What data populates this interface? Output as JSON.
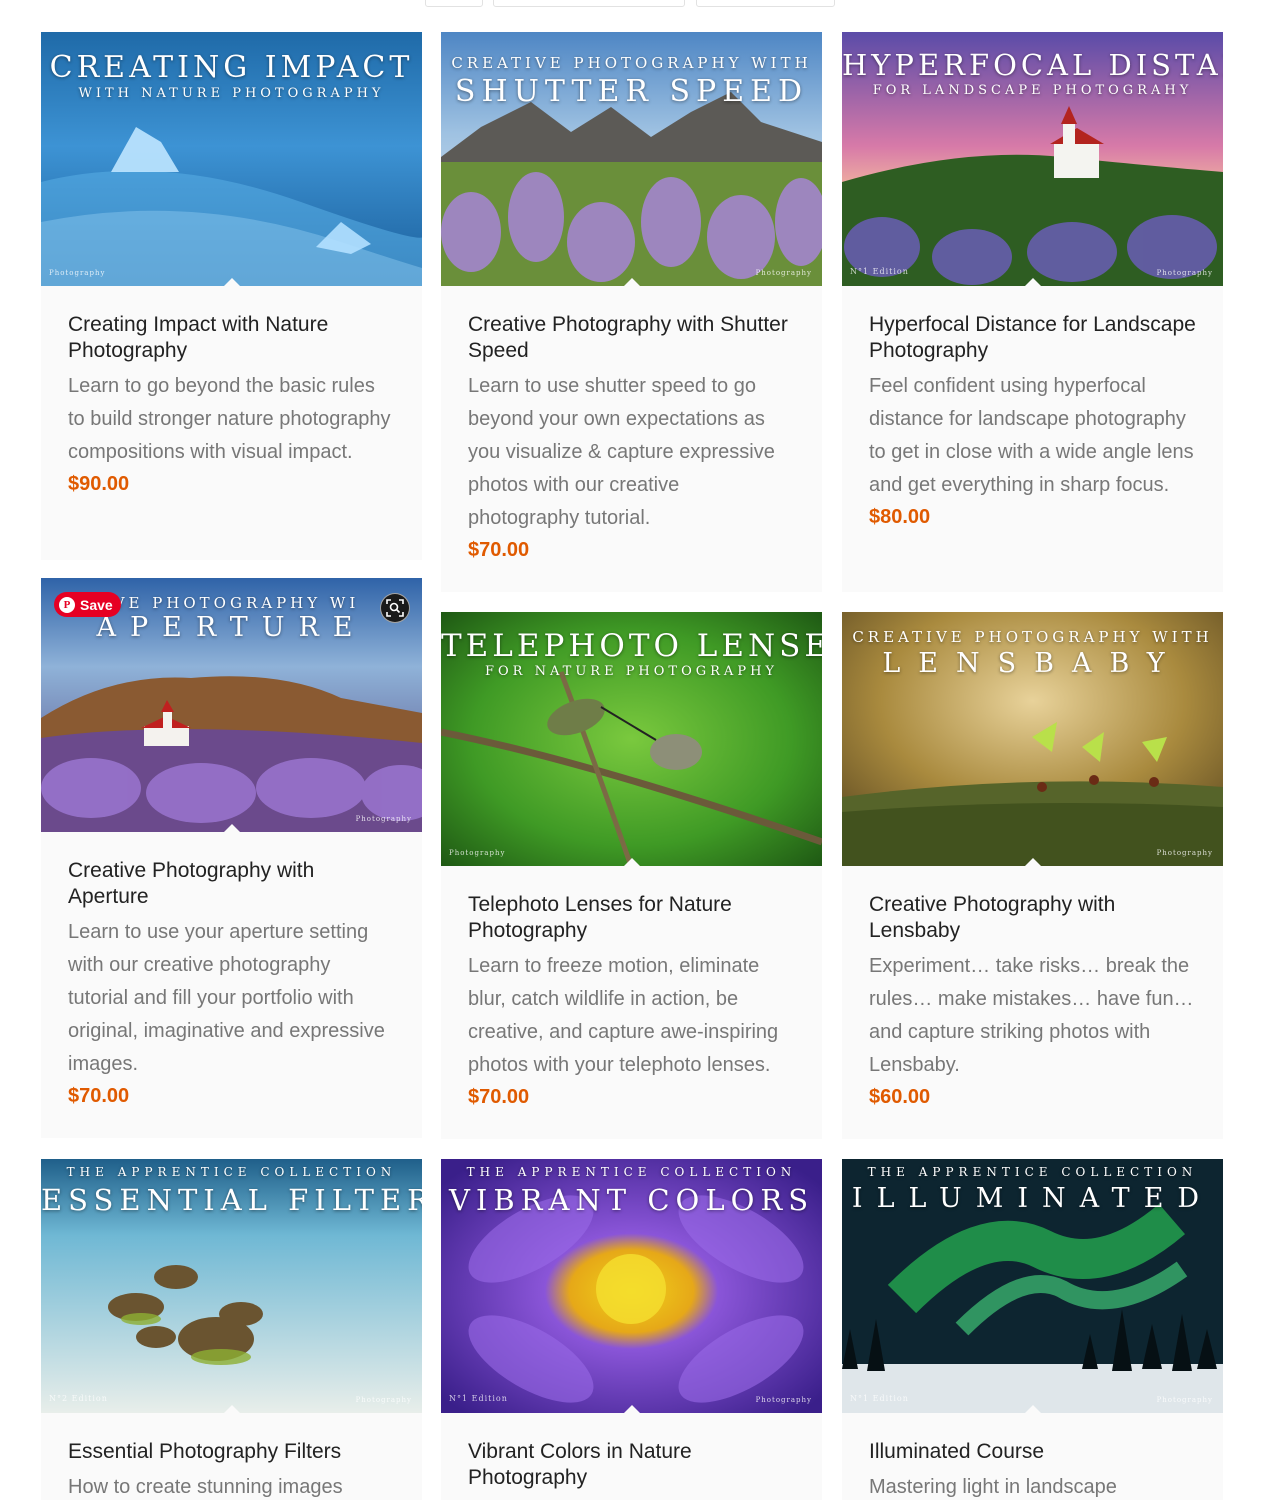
{
  "page": {
    "background": "#ffffff",
    "price_color": "#e05a00",
    "card_background": "#fafafa"
  },
  "products": [
    {
      "title": "Creating Impact with Nature Photography",
      "description": "Learn to go beyond the basic rules to build stronger nature photography compositions with visual impact.",
      "price": "$90.00",
      "cover": {
        "main": "Creating Impact",
        "sub": "With Nature Photography"
      }
    },
    {
      "title": "Creative Photography with Shutter Speed",
      "description": "Learn to use shutter speed to go beyond your own expectations as you visualize & capture expressive photos with our creative photography tutorial.",
      "price": "$70.00",
      "cover": {
        "pre": "Creative Photography With",
        "main": "Shutter Speed"
      }
    },
    {
      "title": "Hyperfocal Distance for Landscape Photography",
      "description": "Feel confident using hyperfocal distance for landscape photography to get in close with a wide angle lens and get everything in sharp focus.",
      "price": "$80.00",
      "cover": {
        "main": "Hyperfocal Distance",
        "sub": "For Landscape Photograhy"
      }
    },
    {
      "title": "Creative Photography with Aperture",
      "description": "Learn to use your aperture setting with our creative photography tutorial and fill your portfolio with original, imaginative and expressive images.",
      "price": "$70.00",
      "cover": {
        "pre": "ive Photography Wi",
        "main": "Aperture"
      }
    },
    {
      "title": "Telephoto Lenses for Nature Photography",
      "description": "Learn to freeze motion, eliminate blur, catch wildlife in action, be creative, and capture awe-inspiring photos with your telephoto lenses.",
      "price": "$70.00",
      "cover": {
        "main": "Telephoto Lenses",
        "sub": "For Nature Photography"
      }
    },
    {
      "title": "Creative Photography with Lensbaby",
      "description": "Experiment… take risks… break the rules… make mistakes… have fun… and capture striking photos with Lensbaby.",
      "price": "$60.00",
      "cover": {
        "pre": "Creative Photography With",
        "main": "Lensbaby"
      }
    },
    {
      "title": "Essential Photography Filters",
      "description": "How to create stunning images",
      "cover": {
        "pre": "The Apprentice Collection",
        "main": "Essential Filters"
      }
    },
    {
      "title": "Vibrant Colors in Nature Photography",
      "description": "",
      "cover": {
        "pre": "The Apprentice Collection",
        "main": "Vibrant Colors"
      }
    },
    {
      "title": "Illuminated Course",
      "description": "Mastering light in landscape",
      "cover": {
        "pre": "The Apprentice Collection",
        "main": "Illuminated"
      }
    }
  ],
  "overlay": {
    "save_label": "Save",
    "pinterest_glyph": "P"
  },
  "branding": {
    "photography": "Photography",
    "edition_1": "N°1 Edition",
    "edition_2": "N°2 Edition"
  },
  "icons": {
    "lens": "visual-search-icon",
    "pin": "pinterest-icon"
  }
}
